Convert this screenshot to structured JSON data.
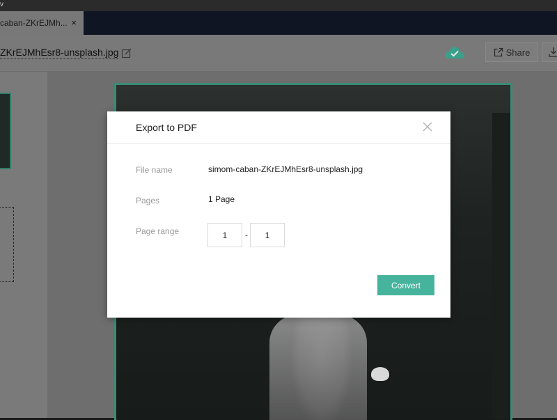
{
  "window": {
    "titlebar_glyph": "v"
  },
  "tab": {
    "label": "caban-ZKrEJMh...",
    "close_glyph": "×"
  },
  "toolbar": {
    "filename": "ZKrEJMhEsr8-unsplash.jpg",
    "edit_icon": "edit-icon",
    "cloud_icon": "cloud-sync-icon",
    "share_label": "Share"
  },
  "dialog": {
    "title": "Export to PDF",
    "close_icon": "close-icon",
    "file_name_label": "File name",
    "file_name_value": "simom-caban-ZKrEJMhEsr8-unsplash.jpg",
    "pages_label": "Pages",
    "pages_value": "1 Page",
    "page_range_label": "Page range",
    "range_from": "1",
    "range_separator": "-",
    "range_to": "1",
    "convert_label": "Convert"
  },
  "colors": {
    "accent": "#46b49d",
    "cloud": "#3aa08a",
    "canvas_border": "#3a8c75"
  }
}
